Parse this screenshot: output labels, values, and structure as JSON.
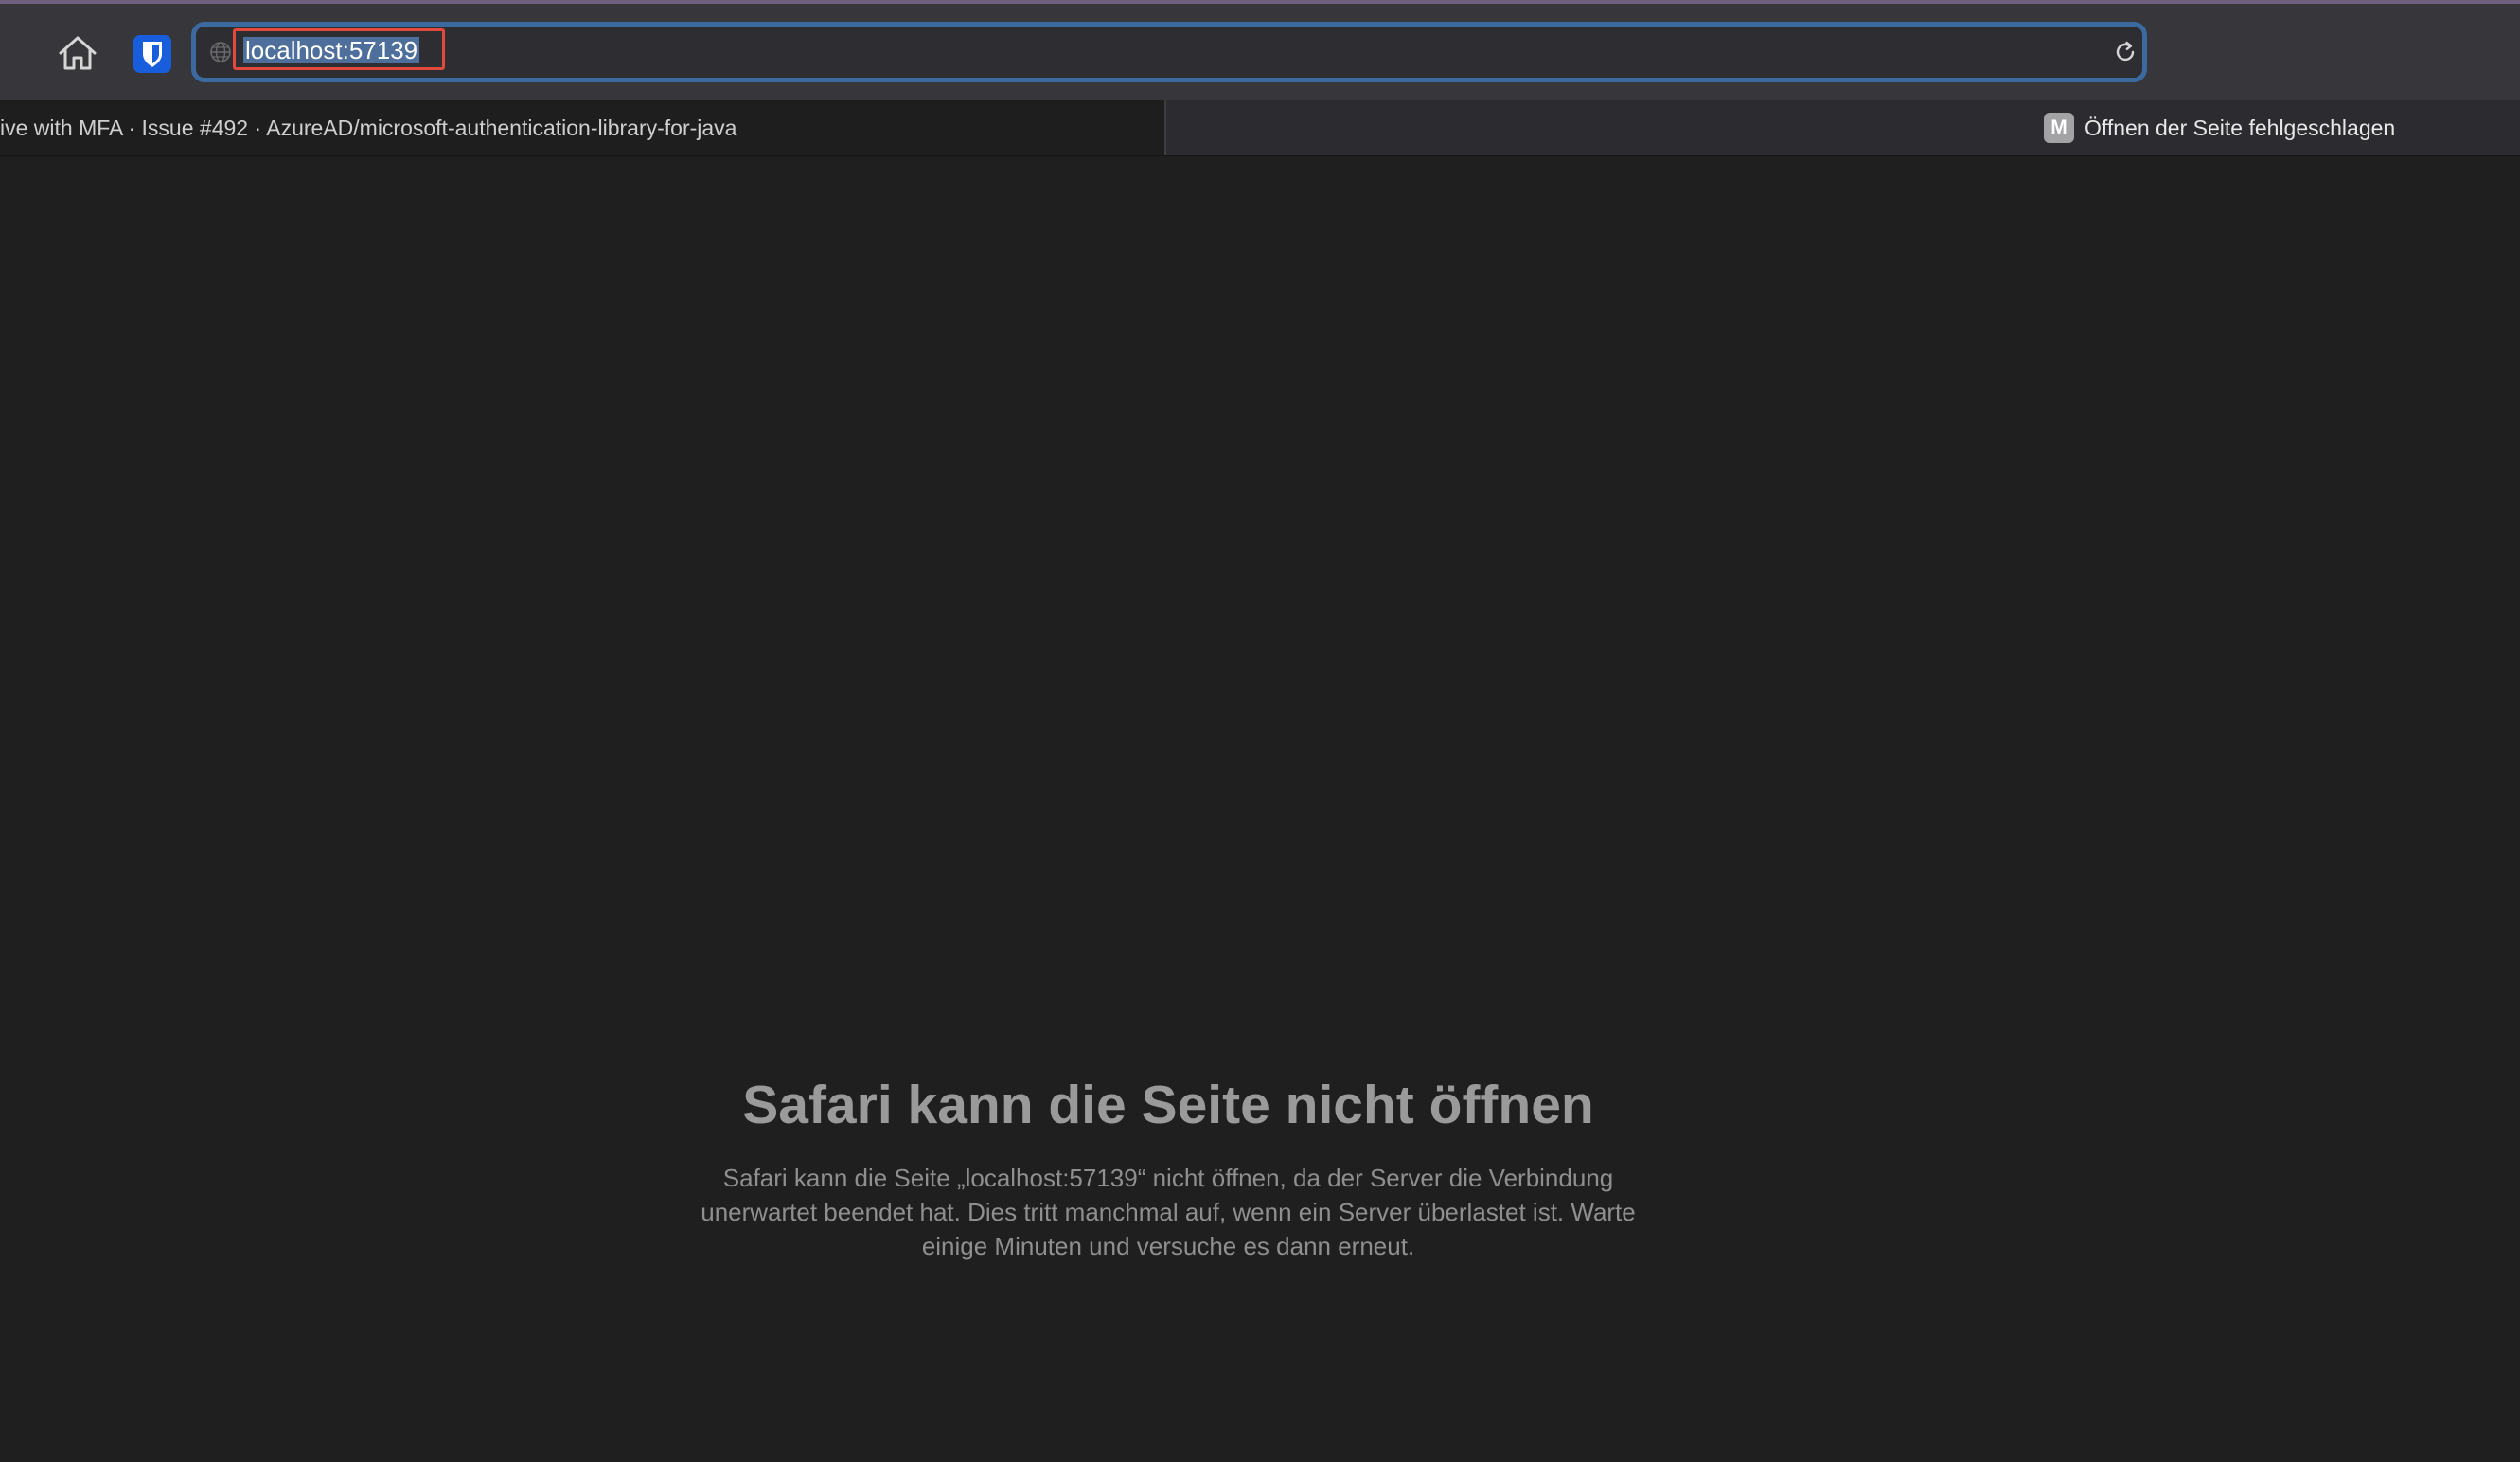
{
  "toolbar": {
    "home_icon": "home-icon",
    "bitwarden_icon": "bitwarden-shield-icon",
    "address": {
      "url": "localhost:57139",
      "globe_icon": "globe-icon",
      "reload_icon": "reload-icon"
    }
  },
  "tabs": [
    {
      "label": "ive with MFA · Issue #492 · AzureAD/microsoft-authentication-library-for-java",
      "active": true
    },
    {
      "label": "Öffnen der Seite fehlgeschlagen",
      "favicon": "M",
      "active": false
    }
  ],
  "error": {
    "title": "Safari kann die Seite nicht öffnen",
    "message_line1": "Safari kann die Seite „localhost:57139“ nicht öffnen, da der Server die Verbindung",
    "message_line2": "unerwartet beendet hat. Dies tritt manchmal auf, wenn ein Server überlastet ist. Warte",
    "message_line3": "einige Minuten und versuche es dann erneut."
  },
  "colors": {
    "toolbar_bg": "#37363a",
    "page_bg": "#1f1f1f",
    "address_focus": "#3b6aa0",
    "highlight_box": "#e24a3c"
  }
}
